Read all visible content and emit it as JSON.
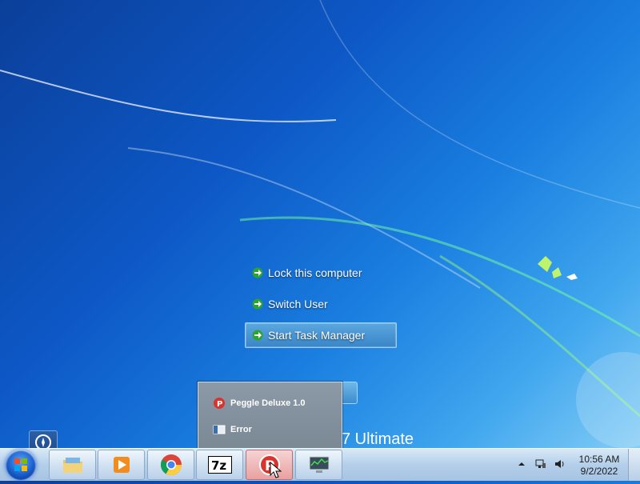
{
  "security_options": {
    "lock": "Lock this computer",
    "switch_user": "Switch User",
    "task_manager": "Start Task Manager"
  },
  "edition_text": "7 Ultimate",
  "jumplist": {
    "items": [
      {
        "label": "Peggle Deluxe 1.0",
        "icon": "peggle-icon"
      },
      {
        "label": "Error",
        "icon": "window-icon"
      }
    ]
  },
  "taskbar": {
    "buttons": [
      {
        "name": "file-explorer",
        "icon": "folder-icon"
      },
      {
        "name": "media-player",
        "icon": "media-player-icon"
      },
      {
        "name": "chrome",
        "icon": "chrome-icon"
      },
      {
        "name": "7zip",
        "icon": "7z-icon",
        "text": "7z"
      },
      {
        "name": "peggle",
        "icon": "peggle-icon",
        "active": true
      },
      {
        "name": "task-manager",
        "icon": "monitor-icon"
      }
    ],
    "clock": {
      "time": "10:56 AM",
      "date": "9/2/2022"
    }
  },
  "colors": {
    "desktop_blue": "#0d58c6",
    "selected_option": "#3a85c7",
    "jumplist_bg": "#7b8995"
  }
}
